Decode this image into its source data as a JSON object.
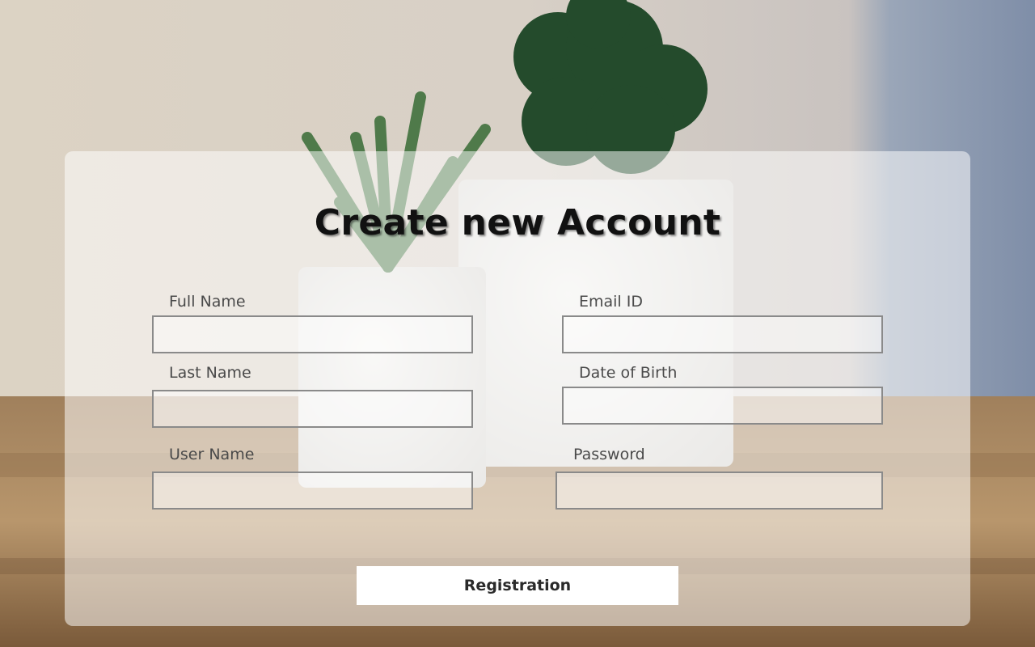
{
  "form": {
    "title": "Create new Account",
    "fields": {
      "full_name": {
        "label": "Full Name",
        "value": ""
      },
      "email": {
        "label": "Email ID",
        "value": ""
      },
      "last_name": {
        "label": "Last Name",
        "value": ""
      },
      "dob": {
        "label": "Date of Birth",
        "value": ""
      },
      "username": {
        "label": "User Name",
        "value": ""
      },
      "password": {
        "label": "Password",
        "value": ""
      }
    },
    "submit_label": "Registration"
  },
  "colors": {
    "panel": "#ffffff",
    "title": "#111111",
    "label": "#4a4a4a",
    "field_border": "#8a8a8a"
  },
  "background": {
    "image": "potted-cactus-plants-photo"
  }
}
